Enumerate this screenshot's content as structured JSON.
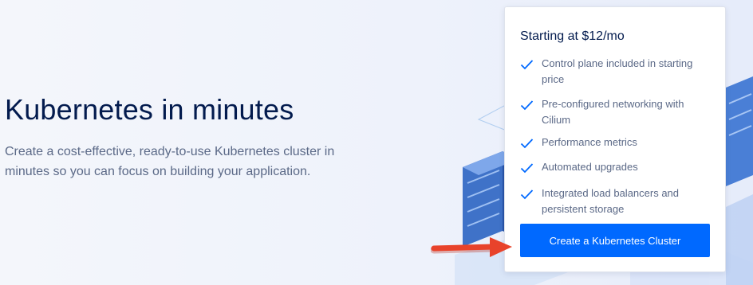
{
  "hero": {
    "title": "Kubernetes in minutes",
    "description": "Create a cost-effective, ready-to-use Kubernetes cluster in minutes so you can focus on building your application."
  },
  "pricing_card": {
    "title": "Starting at $12/mo",
    "features": [
      "Control plane included in starting price",
      "Pre-configured networking with Cilium",
      "Performance metrics",
      "Automated upgrades",
      "Integrated load balancers and persistent storage"
    ],
    "cta_label": "Create a Kubernetes Cluster"
  },
  "colors": {
    "accent": "#0069ff",
    "heading": "#031b4e",
    "body_text": "#5b6987",
    "annotation_arrow": "#e8432b"
  },
  "icons": {
    "feature": "check-icon",
    "annotation": "red-arrow"
  }
}
